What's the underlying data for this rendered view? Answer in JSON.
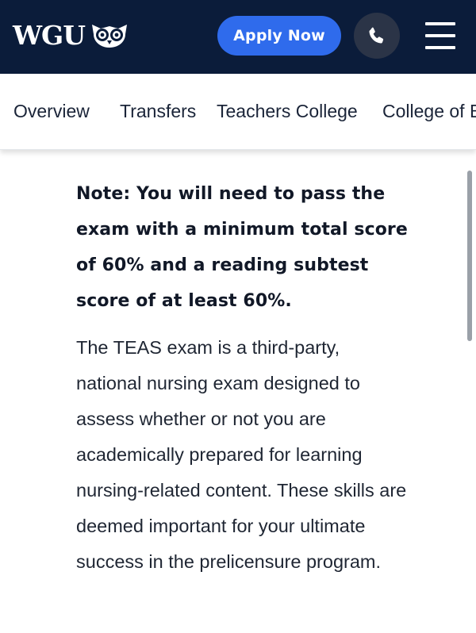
{
  "header": {
    "logo_text": "WGU",
    "logo_icon": "owl-icon",
    "apply_label": "Apply Now",
    "phone_icon": "phone-icon",
    "menu_icon": "hamburger-menu-icon",
    "colors": {
      "navy": "#0b1c3a",
      "accent": "#2f6bec"
    }
  },
  "subnav": {
    "items": [
      {
        "label": "Overview"
      },
      {
        "label": "Transfers"
      },
      {
        "label": "Teachers College"
      },
      {
        "label": "College of B"
      }
    ]
  },
  "main": {
    "note": "Note: You will need to pass the exam with a minimum total score of 60% and a reading subtest score of at least 60%.",
    "paragraph": "The TEAS exam is a third-party, national nursing exam designed to assess whether or not you are academically prepared for learning nursing-related content. These skills are deemed important for your ultimate success in the prelicensure program."
  }
}
